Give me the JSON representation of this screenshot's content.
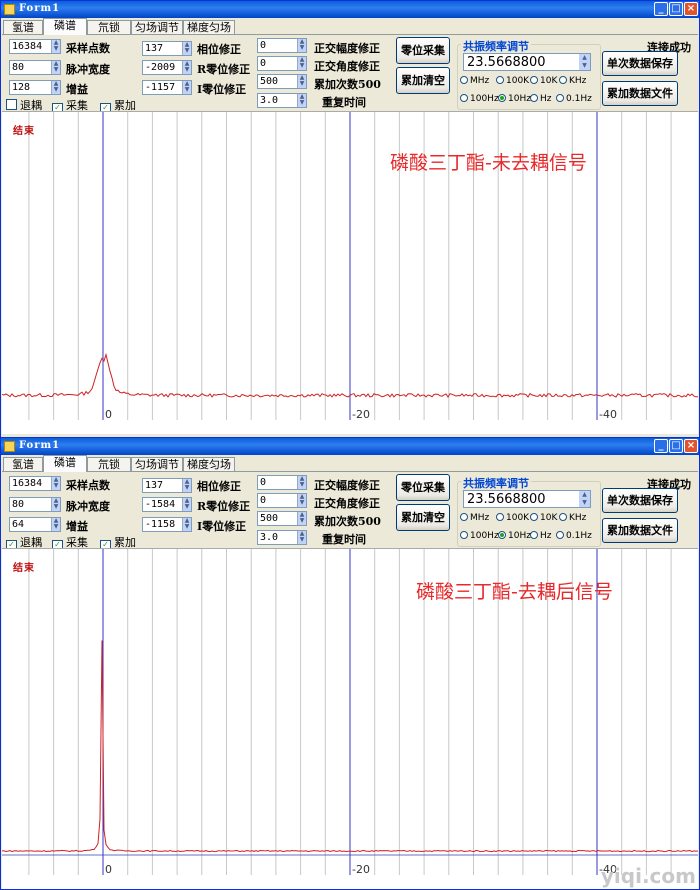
{
  "windows": [
    {
      "title": "Form1",
      "tabs": [
        "氢谱",
        "磷谱",
        "氘锁",
        "匀场调节",
        "梯度匀场"
      ],
      "active_tab": 1,
      "params": {
        "sample_points": "16384",
        "sample_points_label": "采样点数",
        "pulse_width": "80",
        "pulse_width_label": "脉冲宽度",
        "gain": "128",
        "gain_label": "增益",
        "phase": "137",
        "phase_label": "相位修正",
        "r_zero": "-2009",
        "r_zero_label": "R零位修正",
        "i_zero": "-1157",
        "i_zero_label": "I零位修正",
        "quad_amp": "0",
        "quad_amp_label": "正交幅度修正",
        "quad_angle": "0",
        "quad_angle_label": "正交角度修正",
        "accum": "500",
        "accum_label": "累加次数500",
        "repeat": "3.0",
        "repeat_label": "重复时间"
      },
      "checkboxes": [
        {
          "label": "退耦",
          "checked": false
        },
        {
          "label": "采集",
          "checked": true
        },
        {
          "label": "累加",
          "checked": true
        }
      ],
      "buttons": {
        "zero_acquire": "零位采集",
        "accum_clear": "累加清空",
        "single_save": "单次数据保存",
        "accum_file": "累加数据文件"
      },
      "freq_group_label": "共振频率调节",
      "freq_value": "23.5668800",
      "connection": "连接成功",
      "radios_row1": [
        {
          "label": "MHz",
          "on": false
        },
        {
          "label": "100K",
          "on": false
        },
        {
          "label": "10K",
          "on": false
        },
        {
          "label": "KHz",
          "on": false
        }
      ],
      "radios_row2": [
        {
          "label": "100Hz",
          "on": false
        },
        {
          "label": "10Hz",
          "on": true
        },
        {
          "label": "Hz",
          "on": false
        },
        {
          "label": "0.1Hz",
          "on": false
        }
      ],
      "plot_status": "结束",
      "overlay": "磷酸三丁酯-未去耦信号",
      "axis_labels": [
        "0",
        "-20",
        "-40"
      ],
      "spectrum": {
        "type": "line",
        "peak_type": "multiplet",
        "x": [
          0,
          -20,
          -40
        ],
        "baseline": 0.02,
        "peak_height": 0.18
      }
    },
    {
      "title": "Form1",
      "tabs": [
        "氢谱",
        "磷谱",
        "氘锁",
        "匀场调节",
        "梯度匀场"
      ],
      "active_tab": 1,
      "params": {
        "sample_points": "16384",
        "sample_points_label": "采样点数",
        "pulse_width": "80",
        "pulse_width_label": "脉冲宽度",
        "gain": "64",
        "gain_label": "增益",
        "phase": "137",
        "phase_label": "相位修正",
        "r_zero": "-1584",
        "r_zero_label": "R零位修正",
        "i_zero": "-1158",
        "i_zero_label": "I零位修正",
        "quad_amp": "0",
        "quad_amp_label": "正交幅度修正",
        "quad_angle": "0",
        "quad_angle_label": "正交角度修正",
        "accum": "500",
        "accum_label": "累加次数500",
        "repeat": "3.0",
        "repeat_label": "重复时间"
      },
      "checkboxes": [
        {
          "label": "退耦",
          "checked": true
        },
        {
          "label": "采集",
          "checked": true
        },
        {
          "label": "累加",
          "checked": true
        }
      ],
      "buttons": {
        "zero_acquire": "零位采集",
        "accum_clear": "累加清空",
        "single_save": "单次数据保存",
        "accum_file": "累加数据文件"
      },
      "freq_group_label": "共振频率调节",
      "freq_value": "23.5668800",
      "connection": "连接成功",
      "radios_row1": [
        {
          "label": "MHz",
          "on": false
        },
        {
          "label": "100K",
          "on": false
        },
        {
          "label": "10K",
          "on": false
        },
        {
          "label": "KHz",
          "on": false
        }
      ],
      "radios_row2": [
        {
          "label": "100Hz",
          "on": false
        },
        {
          "label": "10Hz",
          "on": true
        },
        {
          "label": "Hz",
          "on": false
        },
        {
          "label": "0.1Hz",
          "on": false
        }
      ],
      "plot_status": "结束",
      "overlay": "磷酸三丁酯-去耦后信号",
      "axis_labels": [
        "0",
        "-20",
        "-40"
      ],
      "spectrum": {
        "type": "line",
        "peak_type": "singlet",
        "x": [
          0,
          -20,
          -40
        ],
        "baseline": 0.01,
        "peak_height": 0.78
      }
    }
  ],
  "watermark": "yiqi.com",
  "colors": {
    "title_bar": "#0a5fd8",
    "trace_red": "#d02020",
    "trace_blue": "#3040b0",
    "grid": "#c8c8c8",
    "axis_blue": "#3333cc",
    "overlay_red": "#e8282a"
  }
}
